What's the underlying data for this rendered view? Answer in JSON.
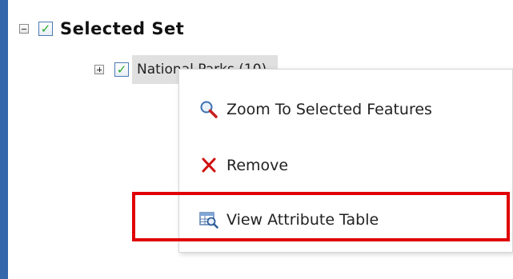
{
  "colors": {
    "background": "#3366aa",
    "check": "#2aa82a",
    "highlight": "#e00000",
    "remove_x": "#d01010"
  },
  "tree": {
    "root": {
      "label": "Selected Set",
      "expander": "minus",
      "checked": true
    },
    "child": {
      "label": "National Parks (10)",
      "expander": "plus",
      "checked": true
    }
  },
  "context_menu": {
    "items": [
      {
        "label": "Zoom To Selected Features",
        "icon": "magnifier-icon"
      },
      {
        "label": "Remove",
        "icon": "x-icon"
      },
      {
        "label": "View Attribute Table",
        "icon": "table-icon"
      }
    ]
  }
}
